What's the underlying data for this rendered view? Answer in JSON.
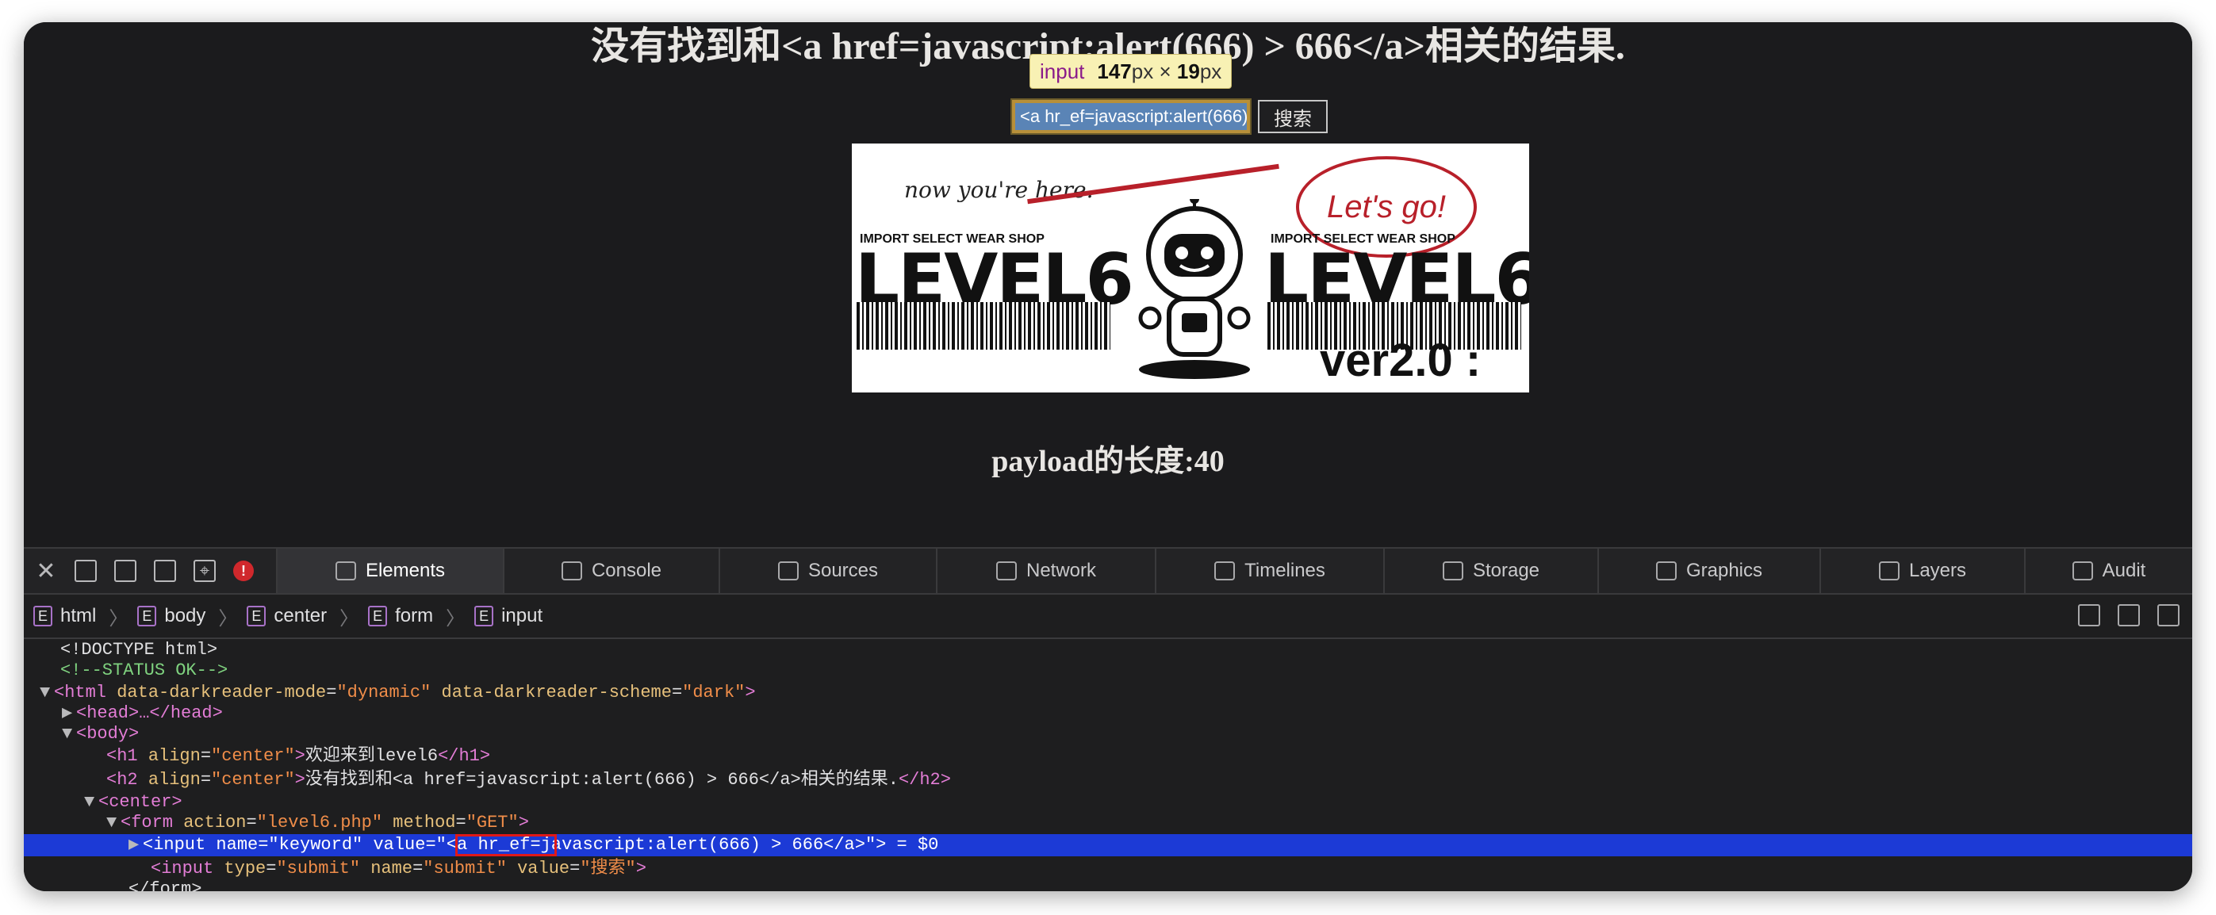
{
  "page": {
    "h2": "没有找到和<a href=javascript:alert(666) > 666</a>相关的结果.",
    "tooltip": {
      "tag": "input",
      "width": "147",
      "unit": "px",
      "times": "×",
      "height": "19",
      "unit2": "px"
    },
    "input_value": "<a hr_ef=javascript:alert(666) > 666</a>",
    "submit_label": "搜索",
    "banner": {
      "now_here": "now you're here.",
      "lets_go": "Let's go!",
      "shop_left": "IMPORT SELECT WEAR SHOP",
      "shop_right": "IMPORT SELECT WEAR SHOP",
      "level_left": "LEVEL6",
      "level_right": "LEVEL6",
      "version": "ver2.0 :"
    },
    "payload": "payload的长度:40"
  },
  "devtools": {
    "tabs": [
      {
        "label": "Elements",
        "icon": "elements-icon"
      },
      {
        "label": "Console",
        "icon": "console-icon"
      },
      {
        "label": "Sources",
        "icon": "sources-icon"
      },
      {
        "label": "Network",
        "icon": "network-icon"
      },
      {
        "label": "Timelines",
        "icon": "timelines-icon"
      },
      {
        "label": "Storage",
        "icon": "storage-icon"
      },
      {
        "label": "Graphics",
        "icon": "graphics-icon"
      },
      {
        "label": "Layers",
        "icon": "layers-icon"
      },
      {
        "label": "Audit",
        "icon": "audit-icon"
      }
    ],
    "error_badge": "!",
    "breadcrumbs": [
      "html",
      "body",
      "center",
      "form",
      "input"
    ],
    "crumb_badge": "E",
    "dom": {
      "doctype": "<!DOCTYPE html>",
      "comment": "<!--STATUS OK-->",
      "html_tag": "<html",
      "html_attr1": "data-darkreader-mode",
      "html_val1": "\"dynamic\"",
      "html_attr2": "data-darkreader-scheme",
      "html_val2": "\"dark\"",
      "head": "<head>…</head>",
      "body": "<body>",
      "h1_open": "<h1",
      "h1_attr": "align",
      "h1_val": "\"center\"",
      "h1_text": "欢迎来到level6",
      "h1_close": "</h1>",
      "h2_open": "<h2",
      "h2_attr": "align",
      "h2_val": "\"center\"",
      "h2_text": "没有找到和<a href=javascript:alert(666) > 666</a>相关的结果.",
      "h2_close": "</h2>",
      "center": "<center>",
      "form_open": "<form",
      "form_attr1": "action",
      "form_val1": "\"level6.php\"",
      "form_attr2": "method",
      "form_val2": "\"GET\"",
      "input1": "<input name=\"keyword\" value=\"<a hr_ef=javascript:alert(666) > 666</a>\"> = $0",
      "input2_open": "<input",
      "input2_attr1": "type",
      "input2_val1": "\"submit\"",
      "input2_attr2": "name",
      "input2_val2": "\"submit\"",
      "input2_attr3": "value",
      "input2_val3": "\"搜索\"",
      "form_close": "</form>"
    }
  }
}
